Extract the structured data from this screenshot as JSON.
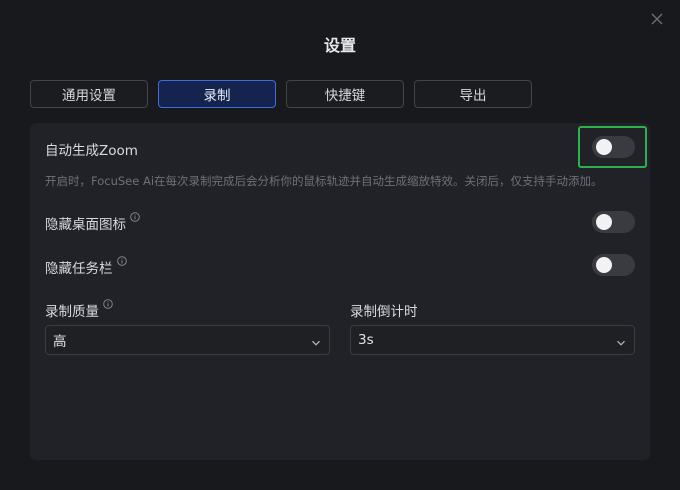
{
  "dialog": {
    "title": "设置"
  },
  "tabs": [
    {
      "label": "通用设置",
      "active": false
    },
    {
      "label": "录制",
      "active": true
    },
    {
      "label": "快捷键",
      "active": false
    },
    {
      "label": "导出",
      "active": false
    }
  ],
  "recording": {
    "auto_zoom": {
      "label": "自动生成Zoom",
      "description": "开启时，FocuSee Ai在每次录制完成后会分析你的鼠标轨迹并自动生成缩放特效。关闭后，仅支持手动添加。",
      "enabled": false
    },
    "hide_desktop_icons": {
      "label": "隐藏桌面图标",
      "enabled": false
    },
    "hide_taskbar": {
      "label": "隐藏任务栏",
      "enabled": false
    },
    "quality": {
      "label": "录制质量",
      "value": "高"
    },
    "countdown": {
      "label": "录制倒计时",
      "value": "3s"
    }
  },
  "colors": {
    "accent": "#3c6ee0",
    "highlight": "#2bb24c"
  },
  "icons": [
    "close-icon",
    "info-icon",
    "chevron-down-icon"
  ]
}
